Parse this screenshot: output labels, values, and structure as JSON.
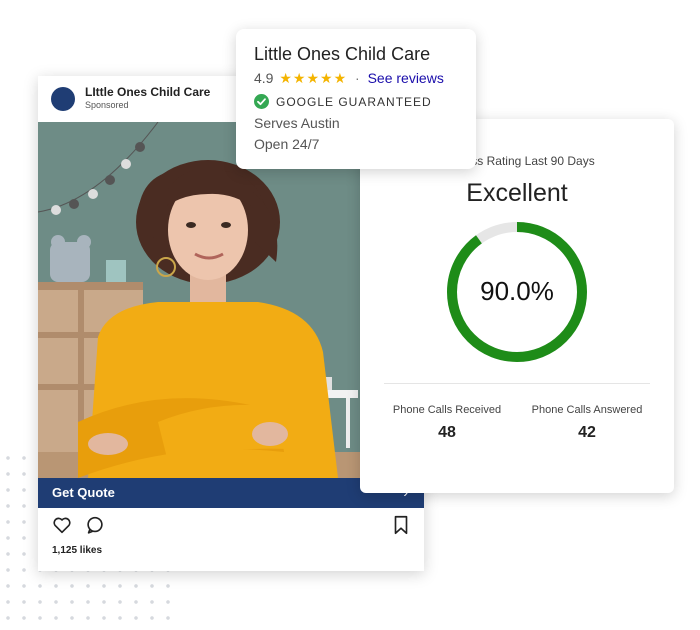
{
  "post": {
    "page_name": "LIttle Ones Child Care",
    "sponsored": "Sponsored",
    "cta_label": "Get Quote",
    "cta_icon": "chevron-right-icon",
    "likes": "1,125 likes",
    "icons": [
      "heart-icon",
      "comment-icon",
      "bookmark-icon"
    ],
    "colors": {
      "brand": "#1f3d74",
      "sweater": "#f2ac14",
      "wall": "#6e8c86"
    }
  },
  "listing": {
    "business_name": "Little Ones Child Care",
    "rating": "4.9",
    "stars": "★★★★★",
    "separator": "·",
    "reviews_link": "See reviews",
    "badge": "GOOGLE GUARANTEED",
    "serves": "Serves Austin",
    "hours": "Open 24/7",
    "colors": {
      "star": "#f4b400",
      "link": "#1a0dab",
      "check": "#34a853"
    }
  },
  "stats": {
    "title": "…eness Rating Last 90 Days",
    "rating_label": "Excellent",
    "gauge_value": "90.0%",
    "gauge_fraction": 0.9,
    "colors": {
      "gauge": "#1e8c18",
      "track": "#e6e6e6"
    },
    "metrics": [
      {
        "label": "Phone Calls Received",
        "value": "48"
      },
      {
        "label": "Phone Calls Answered",
        "value": "42"
      }
    ]
  }
}
